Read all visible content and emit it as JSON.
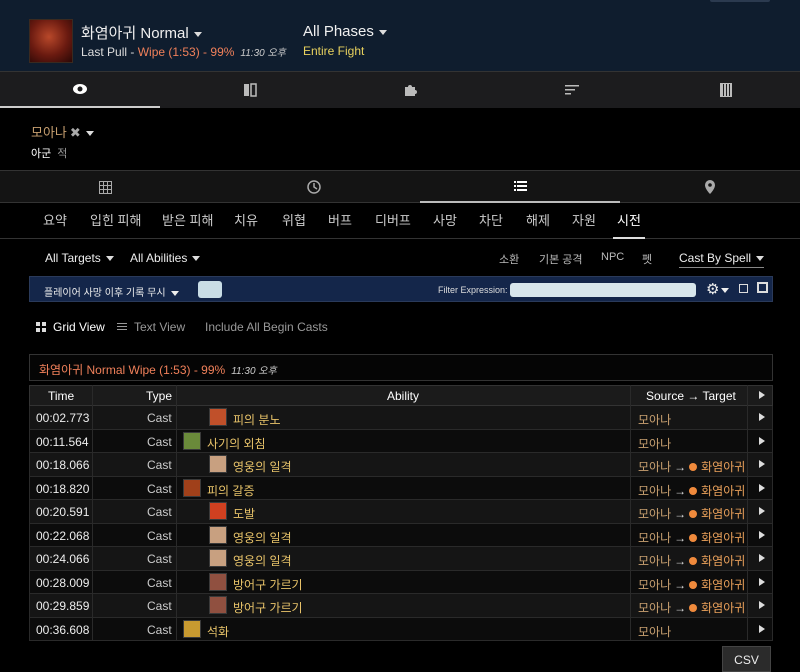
{
  "header": {
    "boss_name": "화염아귀 Normal",
    "last_pull_label": "Last Pull - ",
    "last_pull_result": "Wipe (1:53) - 99%",
    "last_pull_time": "11:30 오후",
    "phase": "All Phases",
    "phase_sub": "Entire Fight"
  },
  "main_tabs": [
    "eye-icon",
    "book-icon",
    "puzzle-icon",
    "sort-icon",
    "columns-icon"
  ],
  "player": {
    "name": "모아나",
    "ally": "아군",
    "enemy": "적"
  },
  "view_tabs": [
    "table-icon",
    "clock-icon",
    "list-icon",
    "location-icon"
  ],
  "text_tabs": [
    "요약",
    "입힌 피해",
    "받은 피해",
    "치유",
    "위협",
    "버프",
    "디버프",
    "사망",
    "차단",
    "해제",
    "자원",
    "시전"
  ],
  "filters": {
    "targets": "All Targets",
    "abilities": "All Abilities",
    "summon": "소환",
    "basic_attack": "기본 공격",
    "npc": "NPC",
    "pet": "펫",
    "cast_by": "Cast By Spell"
  },
  "expr_bar": {
    "ignore_label": "플레이어 사망 이후 기록 무시",
    "filter_label": "Filter Expression:"
  },
  "view_mode": {
    "grid": "Grid View",
    "text": "Text View",
    "include": "Include All Begin Casts"
  },
  "fight_summary": {
    "text": "화염아귀 Normal Wipe (1:53) - 99%",
    "time": "11:30 오후"
  },
  "table": {
    "headers": {
      "time": "Time",
      "type": "Type",
      "ability": "Ability",
      "source_target": "Source → Target"
    },
    "rows": [
      {
        "time": "00:02.773",
        "type": "Cast",
        "ability": "피의 분노",
        "source": "모아나",
        "arrow": "",
        "target": "",
        "icon_color": "#c0502a"
      },
      {
        "time": "00:11.564",
        "type": "Cast",
        "ability": "사기의 외침",
        "source": "모아나",
        "arrow": "",
        "target": "",
        "icon_color": "#6a8a3a"
      },
      {
        "time": "00:18.066",
        "type": "Cast",
        "ability": "영웅의 일격",
        "source": "모아나",
        "arrow": "→",
        "target": "화염아귀",
        "icon_color": "#c8a080"
      },
      {
        "time": "00:18.820",
        "type": "Cast",
        "ability": "피의 갈증",
        "source": "모아나",
        "arrow": "→",
        "target": "화염아귀",
        "icon_color": "#a0401a"
      },
      {
        "time": "00:20.591",
        "type": "Cast",
        "ability": "도발",
        "source": "모아나",
        "arrow": "→",
        "target": "화염아귀",
        "icon_color": "#d04020"
      },
      {
        "time": "00:22.068",
        "type": "Cast",
        "ability": "영웅의 일격",
        "source": "모아나",
        "arrow": "→",
        "target": "화염아귀",
        "icon_color": "#c8a080"
      },
      {
        "time": "00:24.066",
        "type": "Cast",
        "ability": "영웅의 일격",
        "source": "모아나",
        "arrow": "→",
        "target": "화염아귀",
        "icon_color": "#c8a080"
      },
      {
        "time": "00:28.009",
        "type": "Cast",
        "ability": "방어구 가르기",
        "source": "모아나",
        "arrow": "→",
        "target": "화염아귀",
        "icon_color": "#905040"
      },
      {
        "time": "00:29.859",
        "type": "Cast",
        "ability": "방어구 가르기",
        "source": "모아나",
        "arrow": "→",
        "target": "화염아귀",
        "icon_color": "#905040"
      },
      {
        "time": "00:36.608",
        "type": "Cast",
        "ability": "석화",
        "source": "모아나",
        "arrow": "",
        "target": "",
        "icon_color": "#c89a30"
      }
    ]
  },
  "csv_label": "CSV",
  "colors": {
    "header_bg": "#0f1d2e",
    "wipe": "#f0805a",
    "phase_sub": "#e9d25e",
    "ability": "#e9c46a",
    "source": "#c8a070",
    "expr_bar_bg": "#14264a"
  }
}
